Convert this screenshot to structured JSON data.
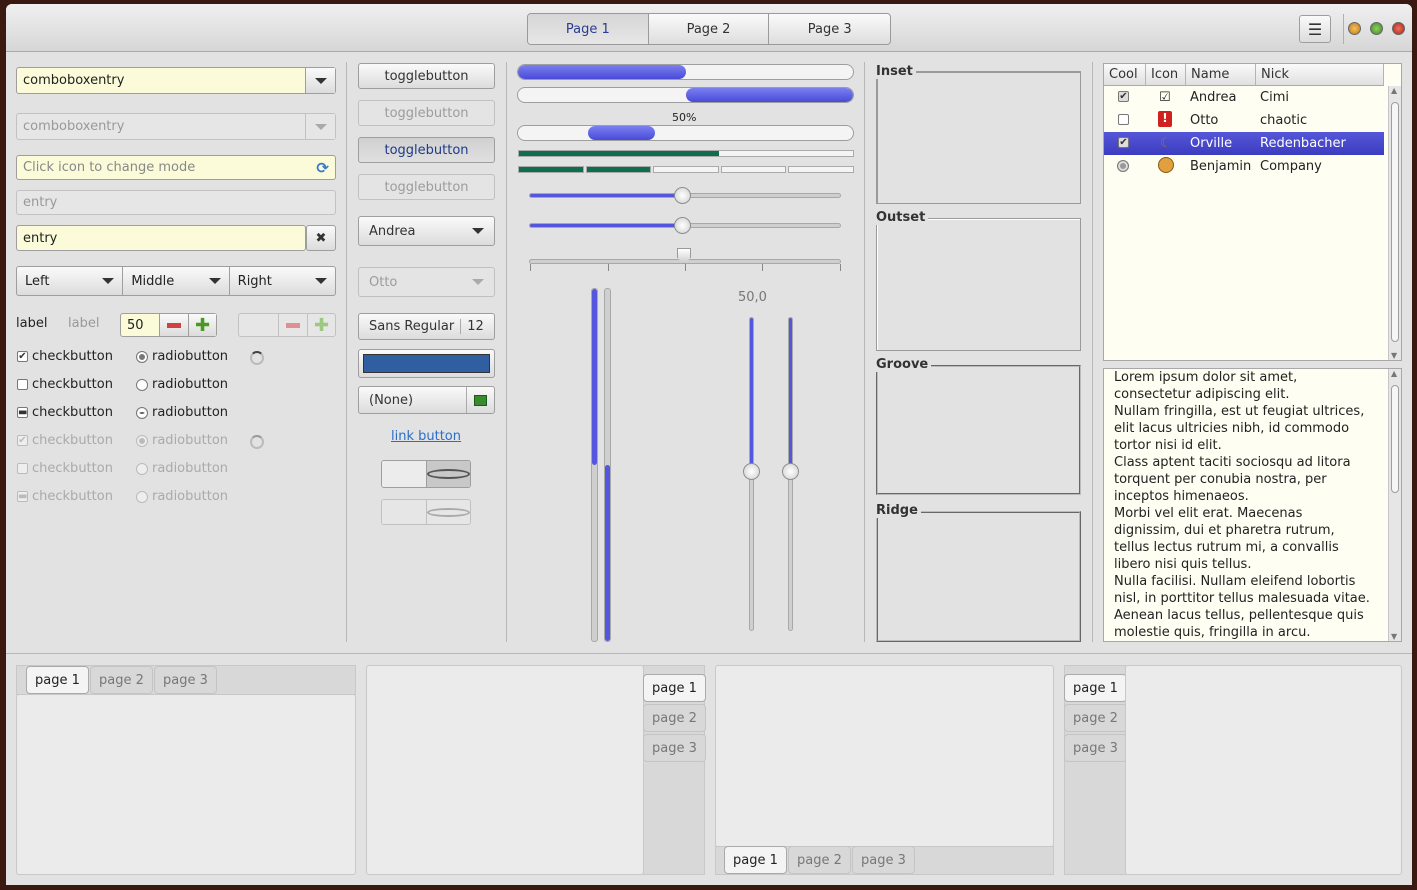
{
  "header": {
    "stack": [
      "Page 1",
      "Page 2",
      "Page 3"
    ],
    "active": 0,
    "menu_icon": "hamburger-menu-icon"
  },
  "col1": {
    "combo1": "comboboxentry",
    "combo2": "comboboxentry",
    "icon_entry_placeholder": "Click icon to change mode",
    "entry_placeholder": "entry",
    "entry_value": "entry",
    "combos": [
      "Left",
      "Middle",
      "Right"
    ],
    "label1": "label",
    "label2": "label",
    "spin_value": "50",
    "checks": [
      "checkbutton",
      "checkbutton",
      "checkbutton",
      "checkbutton",
      "checkbutton",
      "checkbutton"
    ],
    "radios": [
      "radiobutton",
      "radiobutton",
      "radiobutton",
      "radiobutton",
      "radiobutton",
      "radiobutton"
    ]
  },
  "col2": {
    "toggles": [
      "togglebutton",
      "togglebutton",
      "togglebutton",
      "togglebutton"
    ],
    "combo_andrea": "Andrea",
    "combo_otto": "Otto",
    "font_name": "Sans Regular",
    "font_size": "12",
    "color": "#2f5fa0",
    "file": "(None)",
    "link": "link button"
  },
  "col3": {
    "progress_label": "50%",
    "progress": [
      0.5,
      0.5,
      0.42,
      0.6
    ],
    "scale_value": "50,0"
  },
  "col4": {
    "frames": [
      "Inset",
      "Outset",
      "Groove",
      "Ridge"
    ]
  },
  "tree": {
    "columns": [
      "Cool",
      "Icon",
      "Name",
      "Nick"
    ],
    "rows": [
      {
        "cool": "checked",
        "icon": "checkmark-icon",
        "name": "Andrea",
        "nick": "Cimi"
      },
      {
        "cool": "unchecked",
        "icon": "warning-icon",
        "name": "Otto",
        "nick": "chaotic"
      },
      {
        "cool": "checked",
        "icon": "moon-icon",
        "name": "Orville",
        "nick": "Redenbacher"
      },
      {
        "cool": "radio",
        "icon": "face-icon",
        "name": "Benjamin",
        "nick": "Company"
      }
    ],
    "selected": 2
  },
  "text": [
    "Lorem ipsum dolor sit amet,",
    "consectetur adipiscing elit.",
    "Nullam fringilla, est ut feugiat ultrices,",
    "elit lacus ultricies nibh, id commodo",
    "tortor nisi id elit.",
    "Class aptent taciti sociosqu ad litora",
    "torquent per conubia nostra, per",
    "inceptos himenaeos.",
    "Morbi vel elit erat. Maecenas",
    "dignissim, dui et pharetra rutrum,",
    "tellus lectus rutrum mi, a convallis",
    "libero nisi quis tellus.",
    "Nulla facilisi. Nullam eleifend lobortis",
    "nisl, in porttitor tellus malesuada vitae.",
    "Aenean lacus tellus, pellentesque quis",
    "molestie quis, fringilla in arcu."
  ],
  "notebooks": [
    "page 1",
    "page 2",
    "page 3"
  ]
}
